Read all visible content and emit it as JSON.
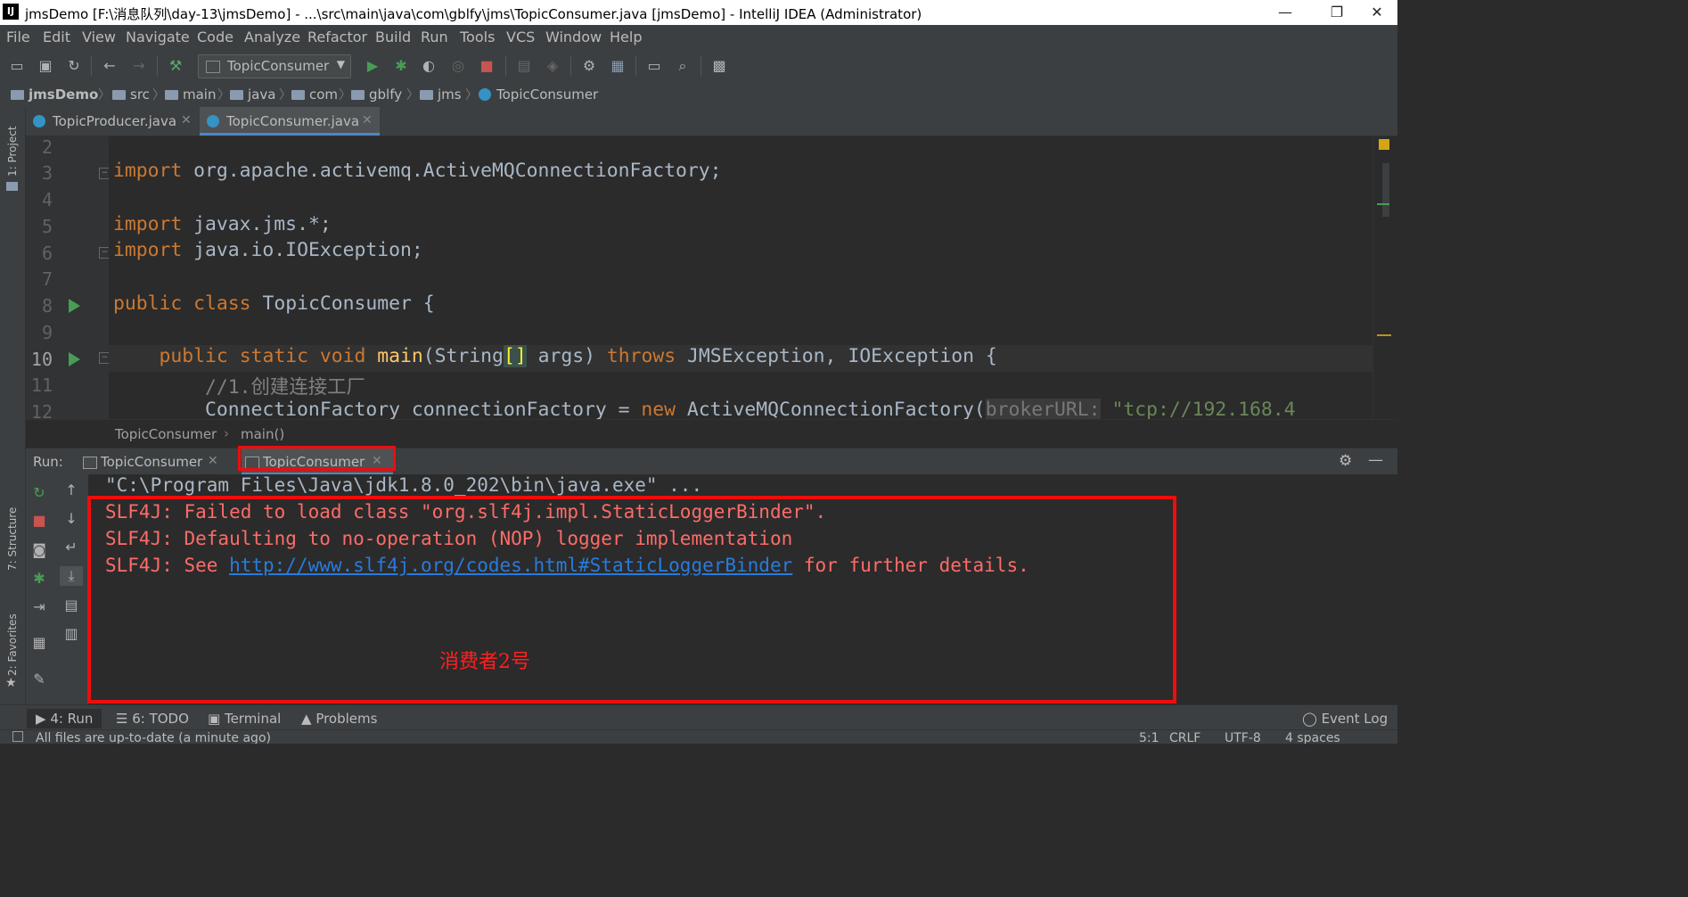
{
  "window": {
    "title": "jmsDemo [F:\\消息队列\\day-13\\jmsDemo] - ...\\src\\main\\java\\com\\gblfy\\jms\\TopicConsumer.java [jmsDemo] - IntelliJ IDEA (Administrator)",
    "logo": "IJ",
    "minimize": "—",
    "restore": "❐",
    "close": "✕"
  },
  "menu": [
    "File",
    "Edit",
    "View",
    "Navigate",
    "Code",
    "Analyze",
    "Refactor",
    "Build",
    "Run",
    "Tools",
    "VCS",
    "Window",
    "Help"
  ],
  "toolbar": {
    "run_config": "TopicConsumer",
    "dropdown_arrow": "▼"
  },
  "breadcrumb": [
    "jmsDemo",
    "src",
    "main",
    "java",
    "com",
    "gblfy",
    "jms",
    "TopicConsumer"
  ],
  "side_tools": {
    "project": "1: Project",
    "structure": "7: Structure",
    "favorites": "2: Favorites"
  },
  "editor_tabs": [
    {
      "label": "TopicProducer.java",
      "close": "✕"
    },
    {
      "label": "TopicConsumer.java",
      "close": "✕"
    }
  ],
  "line_numbers": [
    "2",
    "3",
    "4",
    "5",
    "6",
    "7",
    "8",
    "9",
    "10",
    "11",
    "12"
  ],
  "code": {
    "l3": {
      "kw": "import",
      "rest": " org.apache.activemq.ActiveMQConnectionFactory;"
    },
    "l5": {
      "kw": "import",
      "rest": " javax.jms.*;"
    },
    "l6": {
      "kw": "import",
      "rest": " java.io.IOException;"
    },
    "l8": {
      "kw1": "public",
      "kw2": "class",
      "rest": " TopicConsumer {"
    },
    "l10": {
      "kw1": "public",
      "kw2": "static",
      "kw3": "void",
      "fn": "main",
      "open": "(String",
      "brk": "[]",
      "args": " args) ",
      "throws": "throws",
      "rest": " JMSException, IOException {"
    },
    "l11": {
      "comment": "//1.创建连接工厂"
    },
    "l12": {
      "start": "ConnectionFactory connectionFactory = ",
      "kw": "new",
      "mid": " ActiveMQConnectionFactory(",
      "hint": "brokerURL:",
      "str": " \"tcp://192.168.4"
    }
  },
  "editor_breadcrumb": {
    "cls": "TopicConsumer",
    "method": "main()",
    "sep": "›"
  },
  "run_panel": {
    "label": "Run:",
    "tabs": [
      {
        "label": "TopicConsumer",
        "close": "✕"
      },
      {
        "label": "TopicConsumer",
        "close": "✕"
      }
    ]
  },
  "console": {
    "cmd": "\"C:\\Program Files\\Java\\jdk1.8.0_202\\bin\\java.exe\" ...",
    "line1": "SLF4J: Failed to load class \"org.slf4j.impl.StaticLoggerBinder\".",
    "line2": "SLF4J: Defaulting to no-operation (NOP) logger implementation",
    "line3_prefix": "SLF4J: See ",
    "line3_link": "http://www.slf4j.org/codes.html#StaticLoggerBinder",
    "line3_suffix": " for further details."
  },
  "annotation": "消费者2号",
  "bottom_tabs": {
    "run": "4: Run",
    "todo": "6: TODO",
    "terminal": "Terminal",
    "problems": "Problems",
    "event_log": "Event Log"
  },
  "status": {
    "message": "All files are up-to-date (a minute ago)",
    "position": "5:1",
    "line_sep": "CRLF",
    "encoding": "UTF-8",
    "indent": "4 spaces"
  },
  "colors": {
    "highlight_box": "#f00c0c",
    "keyword": "#cc7832",
    "error_text": "#ff6b68",
    "link": "#287bde"
  }
}
